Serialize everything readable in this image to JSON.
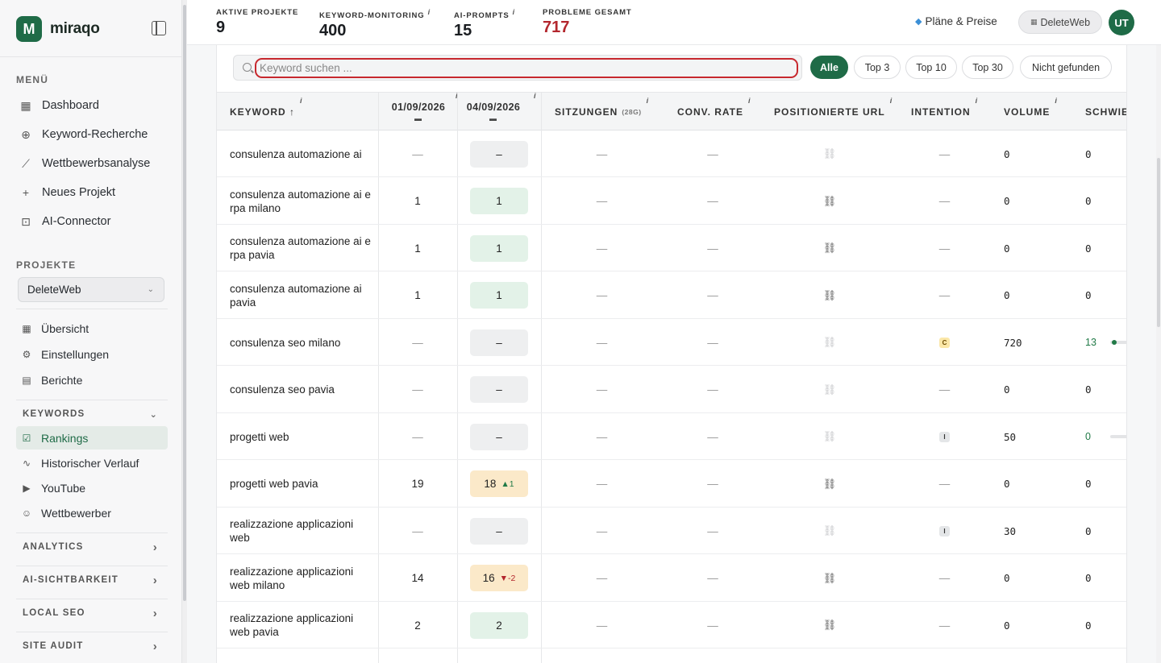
{
  "brand": {
    "logo_letter": "M",
    "name": "miraqo"
  },
  "sidebar": {
    "menu_title": "MENÜ",
    "menu": [
      {
        "label": "Dashboard",
        "icon": "grid-icon"
      },
      {
        "label": "Keyword-Recherche",
        "icon": "search-plus-icon"
      },
      {
        "label": "Wettbewerbsanalyse",
        "icon": "line-chart-icon"
      },
      {
        "label": "Neues Projekt",
        "icon": "plus-icon"
      },
      {
        "label": "AI-Connector",
        "icon": "robot-icon"
      }
    ],
    "projects_title": "PROJEKTE",
    "project_select": "DeleteWeb",
    "project_items": [
      {
        "label": "Übersicht",
        "icon": "grid-icon"
      },
      {
        "label": "Einstellungen",
        "icon": "gear-icon"
      },
      {
        "label": "Berichte",
        "icon": "document-icon"
      }
    ],
    "keywords_group": "KEYWORDS",
    "keyword_items": [
      {
        "label": "Rankings",
        "icon": "checkbox-icon"
      },
      {
        "label": "Historischer Verlauf",
        "icon": "pulse-icon"
      },
      {
        "label": "YouTube",
        "icon": "play-icon"
      },
      {
        "label": "Wettbewerber",
        "icon": "users-icon"
      }
    ],
    "groups": [
      "ANALYTICS",
      "AI-SICHTBARKEIT",
      "LOCAL SEO",
      "SITE AUDIT"
    ]
  },
  "stats": [
    {
      "label": "AKTIVE PROJEKTE",
      "value": "9",
      "info": false
    },
    {
      "label": "KEYWORD-MONITORING",
      "value": "400",
      "info": true
    },
    {
      "label": "AI-PROMPTS",
      "value": "15",
      "info": true
    },
    {
      "label": "PROBLEME GESAMT",
      "value": "717",
      "info": false
    }
  ],
  "header": {
    "plans": "Pläne & Preise",
    "project_chip": "DeleteWeb",
    "avatar": "UT"
  },
  "search": {
    "placeholder": "Keyword suchen ..."
  },
  "filters": [
    "Alle",
    "Top 3",
    "Top 10",
    "Top 30",
    "Nicht gefunden"
  ],
  "table": {
    "headers": {
      "keyword": "KEYWORD ↑",
      "date1": "01/09/2026",
      "date2": "04/09/2026",
      "sessions": "SITZUNGEN",
      "sessions_sub": "(28G)",
      "conv": "CONV. RATE",
      "url": "POSITIONIERTE URL",
      "intent": "INTENTION",
      "volume": "VOLUME",
      "difficulty": "SCHWIE"
    },
    "rows": [
      {
        "keyword": "consulenza automazione ai",
        "d1": "—",
        "d2": "–",
        "d2_style": "gray",
        "change": "",
        "change_dir": "",
        "sessions": "—",
        "conv": "—",
        "url_active": false,
        "intent": "—",
        "volume": "0",
        "difficulty": "0",
        "diff_green": false,
        "diff_bar": false
      },
      {
        "keyword": "consulenza automazione ai e rpa milano",
        "d1": "1",
        "d2": "1",
        "d2_style": "green",
        "change": "",
        "change_dir": "",
        "sessions": "—",
        "conv": "—",
        "url_active": true,
        "intent": "—",
        "volume": "0",
        "difficulty": "0",
        "diff_green": false,
        "diff_bar": false
      },
      {
        "keyword": "consulenza automazione ai e rpa pavia",
        "d1": "1",
        "d2": "1",
        "d2_style": "green",
        "change": "",
        "change_dir": "",
        "sessions": "—",
        "conv": "—",
        "url_active": true,
        "intent": "—",
        "volume": "0",
        "difficulty": "0",
        "diff_green": false,
        "diff_bar": false
      },
      {
        "keyword": "consulenza automazione ai pavia",
        "d1": "1",
        "d2": "1",
        "d2_style": "green",
        "change": "",
        "change_dir": "",
        "sessions": "—",
        "conv": "—",
        "url_active": true,
        "intent": "—",
        "volume": "0",
        "difficulty": "0",
        "diff_green": false,
        "diff_bar": false
      },
      {
        "keyword": "consulenza seo milano",
        "d1": "—",
        "d2": "–",
        "d2_style": "gray",
        "change": "",
        "change_dir": "",
        "sessions": "—",
        "conv": "—",
        "url_active": false,
        "intent": "C",
        "volume": "720",
        "difficulty": "13",
        "diff_green": true,
        "diff_bar": true,
        "diff_dot": true
      },
      {
        "keyword": "consulenza seo pavia",
        "d1": "—",
        "d2": "–",
        "d2_style": "gray",
        "change": "",
        "change_dir": "",
        "sessions": "—",
        "conv": "—",
        "url_active": false,
        "intent": "—",
        "volume": "0",
        "difficulty": "0",
        "diff_green": false,
        "diff_bar": false
      },
      {
        "keyword": "progetti web",
        "d1": "—",
        "d2": "–",
        "d2_style": "gray",
        "change": "",
        "change_dir": "",
        "sessions": "—",
        "conv": "—",
        "url_active": false,
        "intent": "I",
        "volume": "50",
        "difficulty": "0",
        "diff_green": true,
        "diff_bar": true,
        "diff_dot": false
      },
      {
        "keyword": "progetti web pavia",
        "d1": "19",
        "d2": "18",
        "d2_style": "amber",
        "change": "▲1",
        "change_dir": "up",
        "sessions": "—",
        "conv": "—",
        "url_active": true,
        "intent": "—",
        "volume": "0",
        "difficulty": "0",
        "diff_green": false,
        "diff_bar": false
      },
      {
        "keyword": "realizzazione applicazioni web",
        "d1": "—",
        "d2": "–",
        "d2_style": "gray",
        "change": "",
        "change_dir": "",
        "sessions": "—",
        "conv": "—",
        "url_active": false,
        "intent": "I",
        "volume": "30",
        "difficulty": "0",
        "diff_green": false,
        "diff_bar": false
      },
      {
        "keyword": "realizzazione applicazioni web milano",
        "d1": "14",
        "d2": "16",
        "d2_style": "amber",
        "change": "▼-2",
        "change_dir": "down",
        "sessions": "—",
        "conv": "—",
        "url_active": true,
        "intent": "—",
        "volume": "0",
        "difficulty": "0",
        "diff_green": false,
        "diff_bar": false
      },
      {
        "keyword": "realizzazione applicazioni web pavia",
        "d1": "2",
        "d2": "2",
        "d2_style": "green",
        "change": "",
        "change_dir": "",
        "sessions": "—",
        "conv": "—",
        "url_active": true,
        "intent": "—",
        "volume": "0",
        "difficulty": "0",
        "diff_green": false,
        "diff_bar": false
      }
    ]
  }
}
